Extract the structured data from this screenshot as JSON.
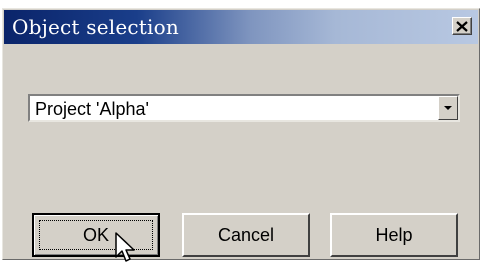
{
  "window": {
    "title": "Object selection",
    "close_icon": "close-x-icon"
  },
  "selection": {
    "value": "Project 'Alpha'",
    "dropdown_icon": "chevron-down-icon"
  },
  "buttons": {
    "ok": "OK",
    "cancel": "Cancel",
    "help": "Help"
  },
  "colors": {
    "title_bar_start": "#0a246a",
    "title_bar_end": "#b8c8e2",
    "dialog_face": "#d4d0c8"
  },
  "cursor": {
    "icon": "mouse-pointer-icon"
  }
}
